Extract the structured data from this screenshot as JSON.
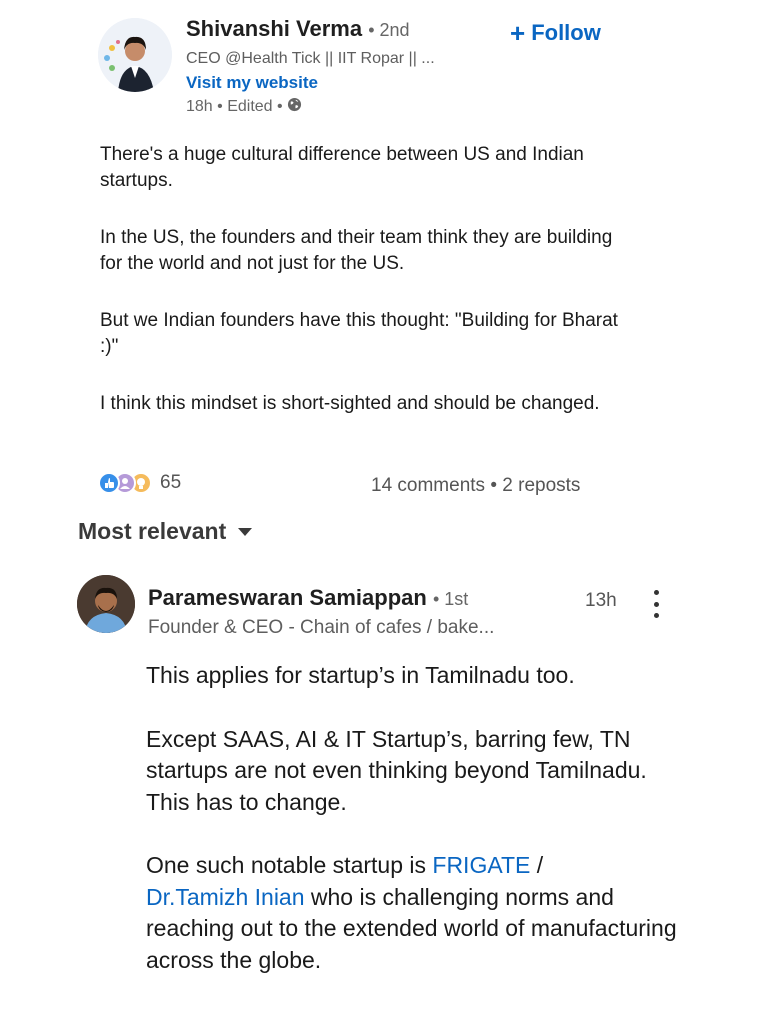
{
  "post": {
    "author": {
      "name": "Shivanshi Verma",
      "degree": "• 2nd",
      "headline": "CEO @Health Tick || IIT Ropar || ...",
      "website_label": "Visit my website",
      "meta": "18h • Edited •",
      "globe_icon": "globe-icon"
    },
    "follow_label": "Follow",
    "paragraphs": [
      "There's a huge cultural difference between US and Indian startups.",
      "In the US, the founders and their team think they are building for the world and not just for the US.",
      "But we Indian founders have this thought: \"Building for Bharat :)\"",
      "I think this mindset is short-sighted and should be changed."
    ],
    "reactions_count": "65",
    "comments_label": "14 comments",
    "separator": " • ",
    "reposts_label": "2 reposts"
  },
  "sort": {
    "label": "Most relevant"
  },
  "comment": {
    "name": "Parameswaran Samiappan",
    "degree": "• 1st",
    "headline": "Founder & CEO - Chain of cafes / bake...",
    "time": "13h",
    "p1": "This applies for startup’s in Tamilnadu too.",
    "p2": "Except SAAS, AI & IT Startup’s, barring few, TN startups are not even thinking beyond Tamilnadu. This has to change.",
    "p3_start": "One such notable startup is ",
    "mention1": "FRIGATE",
    "p3_sep": " /",
    "mention2": "Dr.Tamizh Inian",
    "p3_end": " who is challenging norms and reaching out to the extended world of manufacturing across the globe."
  },
  "colors": {
    "link": "#0a66c2",
    "text": "#1a1a1a",
    "muted": "#5e5e5e"
  }
}
